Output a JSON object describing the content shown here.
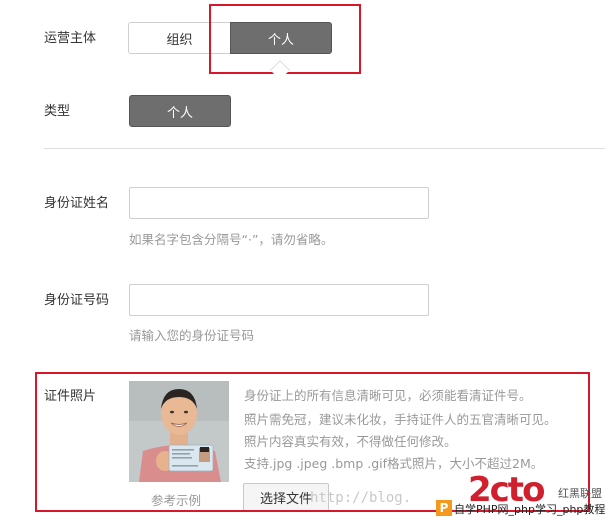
{
  "operator": {
    "label": "运营主体",
    "options": [
      "组织",
      "个人"
    ],
    "selected": "个人"
  },
  "type": {
    "label": "类型",
    "value": "个人"
  },
  "id_name": {
    "label": "身份证姓名",
    "value": "",
    "hint": "如果名字包含分隔号“·”，请勿省略。"
  },
  "id_number": {
    "label": "身份证号码",
    "value": "",
    "hint": "请输入您的身份证号码"
  },
  "id_photo": {
    "label": "证件照片",
    "example_caption": "参考示例",
    "info_lines": [
      "身份证上的所有信息清晰可见，必须能看清证件号。",
      "照片需免冠，建议未化妆，手持证件人的五官清晰可见。",
      "照片内容真实有效，不得做任何修改。",
      "支持.jpg .jpeg .bmp .gif格式照片，大小不超过2M。"
    ],
    "choose_button": "选择文件"
  },
  "watermark": {
    "url_text": "http://blog.",
    "brand": "2cto",
    "brand_cn": "红黑联盟",
    "badge_letter": "P",
    "badge_text": "自学PHP网_php学习_php教程"
  },
  "colors": {
    "highlight_red": "#d6182a",
    "selected_gray": "#6e6e6e",
    "brand_red": "#d0202e"
  }
}
